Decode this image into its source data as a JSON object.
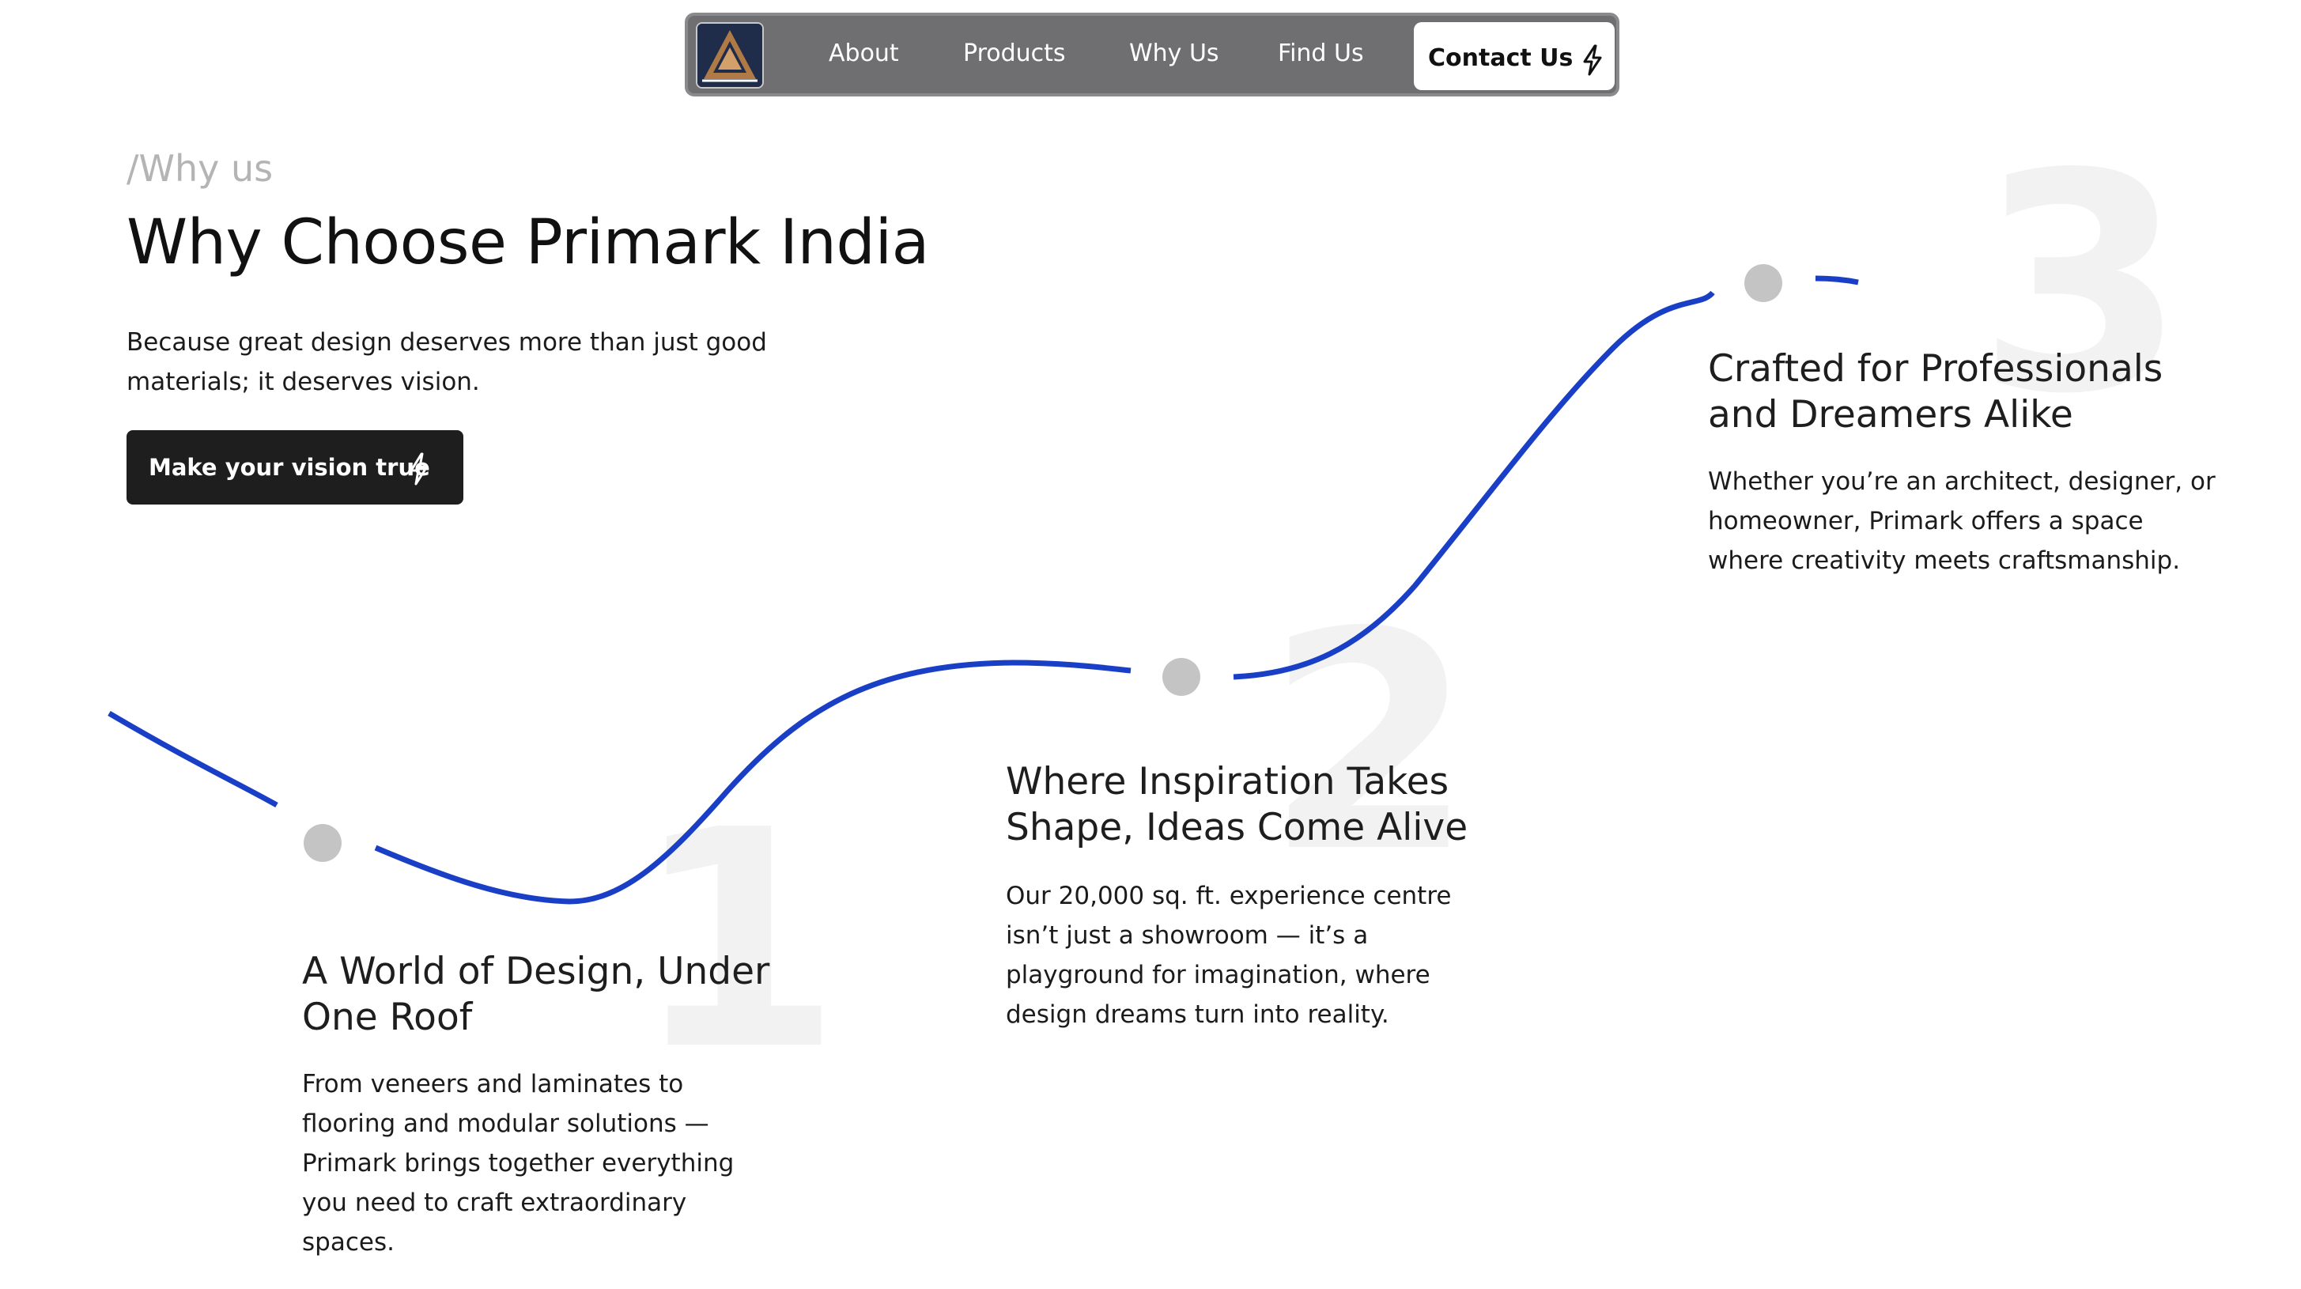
{
  "nav": {
    "logo_name": "primark-logo",
    "links": [
      "About",
      "Products",
      "Why Us",
      "Find Us"
    ],
    "contact_label": "Contact Us",
    "contact_icon": "lightning-icon"
  },
  "hero": {
    "eyebrow": "/Why us",
    "title": "Why Choose Primark India",
    "subtitle": "Because great design deserves more than just good materials; it deserves vision.",
    "cta_label": "Make your vision true",
    "cta_icon": "lightning-icon"
  },
  "steps": [
    {
      "number": "1",
      "title": "A World of Design, Under One Roof",
      "text": "From veneers and laminates to flooring and modular solutions — Primark brings together everything you need to craft extraordinary spaces."
    },
    {
      "number": "2",
      "title": "Where Inspiration Takes Shape, Ideas Come Alive",
      "text": "Our 20,000 sq. ft. experience centre isn’t just a showroom — it’s a playground for imagination, where design dreams turn into reality."
    },
    {
      "number": "3",
      "title": "Crafted for Professionals and Dreamers Alike",
      "text": "Whether you’re an architect, designer, or homeowner, Primark offers a space where creativity meets craftsmanship."
    }
  ],
  "colors": {
    "curve": "#1a3fc7",
    "dot": "#c4c4c4",
    "nav_bg": "#6f6f71"
  }
}
